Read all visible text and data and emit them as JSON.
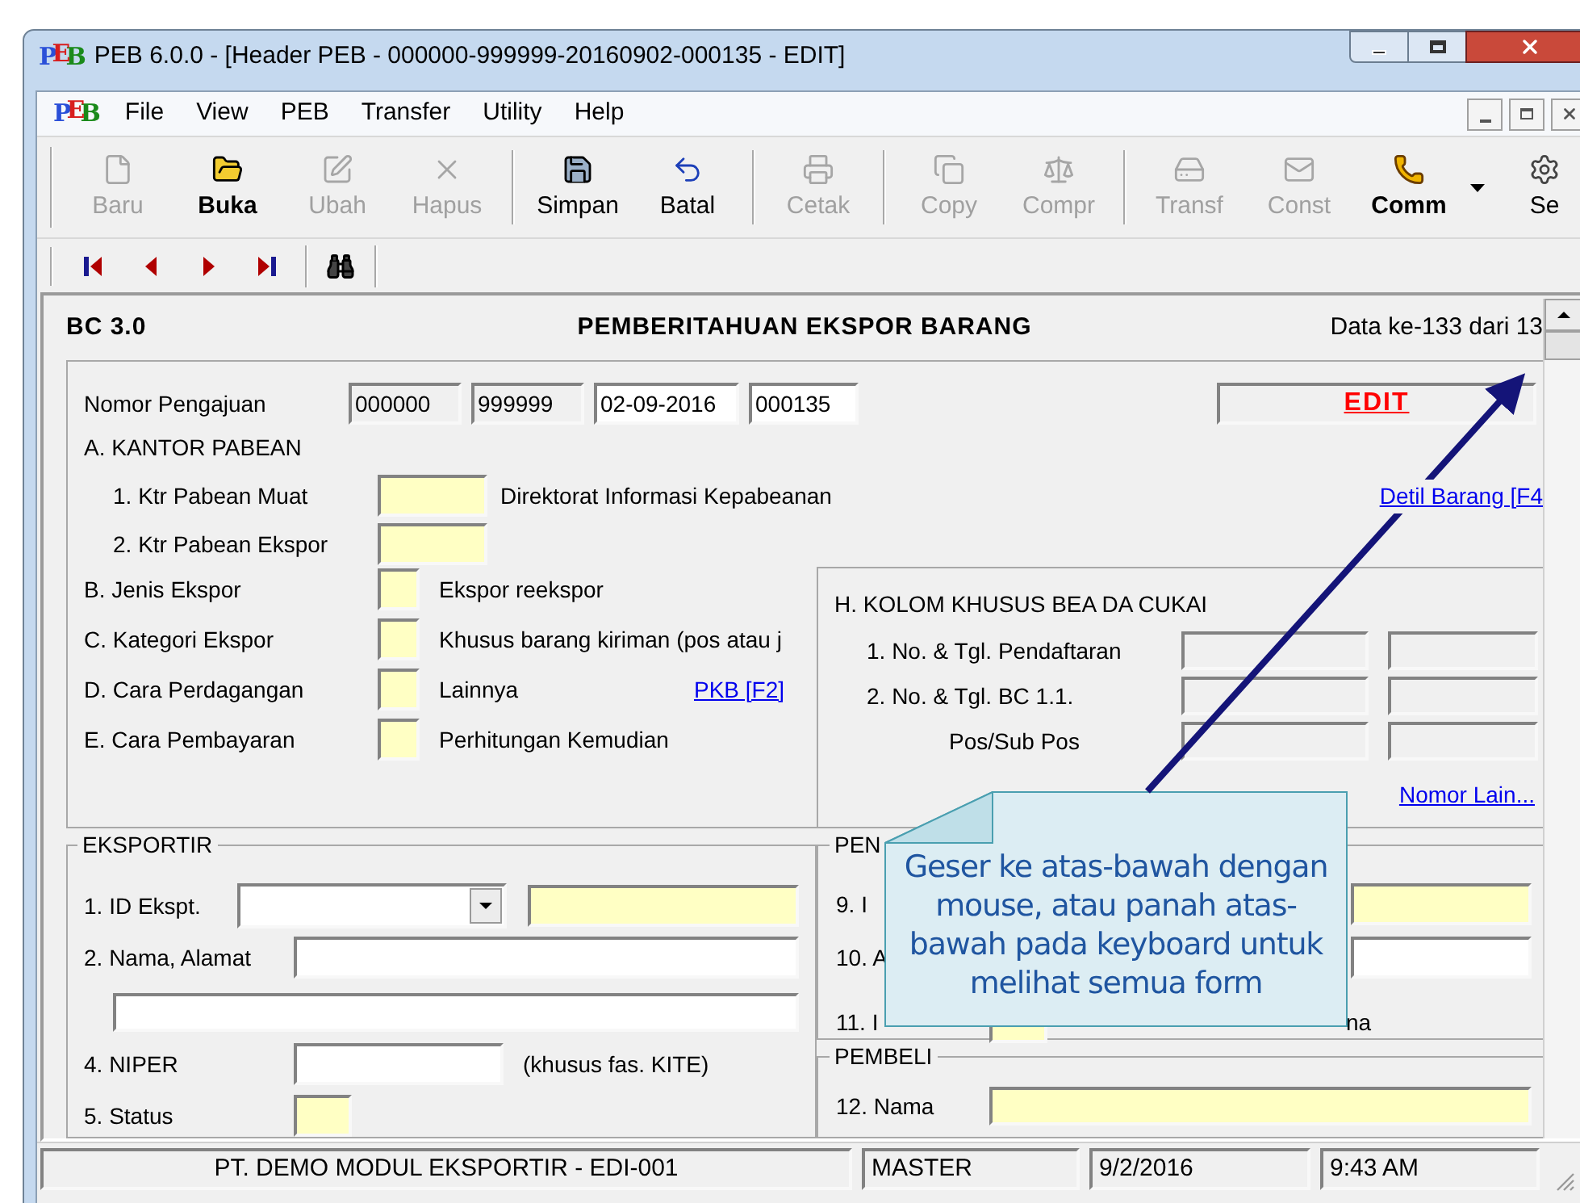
{
  "window": {
    "logo": "PEB",
    "title": "PEB 6.0.0 - [Header PEB - 000000-999999-20160902-000135 - EDIT]"
  },
  "menu_bar": {
    "logo": "PEB",
    "items": [
      "File",
      "View",
      "PEB",
      "Transfer",
      "Utility",
      "Help"
    ]
  },
  "toolbar": [
    [
      {
        "label": "Baru",
        "kind": "new",
        "disabled": true,
        "bold": false
      },
      {
        "label": "Buka",
        "kind": "open",
        "disabled": false,
        "bold": true
      },
      {
        "label": "Ubah",
        "kind": "edit",
        "disabled": true,
        "bold": false
      },
      {
        "label": "Hapus",
        "kind": "delete",
        "disabled": true,
        "bold": false
      }
    ],
    [
      {
        "label": "Simpan",
        "kind": "save",
        "disabled": false,
        "bold": false
      },
      {
        "label": "Batal",
        "kind": "undo",
        "disabled": false,
        "bold": false
      }
    ],
    [
      {
        "label": "Cetak",
        "kind": "print",
        "disabled": true,
        "bold": false
      }
    ],
    [
      {
        "label": "Copy",
        "kind": "copy",
        "disabled": true,
        "bold": false
      },
      {
        "label": "Compr",
        "kind": "compare",
        "disabled": true,
        "bold": false
      }
    ],
    [
      {
        "label": "Transf",
        "kind": "transfer",
        "disabled": true,
        "bold": false
      },
      {
        "label": "Const",
        "kind": "message",
        "disabled": true,
        "bold": false
      },
      {
        "label": "Comm",
        "kind": "phone",
        "disabled": false,
        "bold": true,
        "menu": true
      },
      {
        "label": "Se",
        "kind": "settings",
        "disabled": false,
        "bold": false
      }
    ]
  ],
  "form": {
    "code": "BC 3.0",
    "title": "PEMBERITAHUAN EKSPOR BARANG",
    "record": "Data ke-133 dari 13",
    "nomor_pengajuan": {
      "label": "Nomor Pengajuan",
      "fields": [
        {
          "value": "000000",
          "disabled": true
        },
        {
          "value": "999999",
          "disabled": true
        },
        {
          "value": "02-09-2016",
          "disabled": false
        },
        {
          "value": "000135",
          "disabled": false
        }
      ]
    },
    "mode": "EDIT",
    "kantor_pabean": {
      "heading": "A. KANTOR PABEAN",
      "rows": [
        {
          "label": "1. Ktr Pabean Muat",
          "required": true,
          "description": "Direktorat Informasi Kepabeanan",
          "link": "Detil Barang [F4"
        },
        {
          "label": "2. Ktr Pabean Ekspor",
          "required": true
        }
      ]
    },
    "code_rows": [
      {
        "label": "B. Jenis Ekspor",
        "required": true,
        "description": "Ekspor reekspor"
      },
      {
        "label": "C. Kategori Ekspor",
        "required": true,
        "description": "Khusus barang kiriman (pos atau j"
      },
      {
        "label": "D. Cara Perdagangan",
        "required": true,
        "description": "Lainnya",
        "link": "PKB [F2]"
      },
      {
        "label": "E. Cara Pembayaran",
        "required": true,
        "description": "Perhitungan Kemudian"
      }
    ],
    "bea_cukai": {
      "heading": "H. KOLOM KHUSUS BEA DA CUKAI",
      "rows": [
        {
          "label": "1. No. & Tgl. Pendaftaran"
        },
        {
          "label": "2. No. & Tgl. BC 1.1.",
          "children": [
            {
              "label": "Pos/Sub Pos"
            }
          ]
        }
      ],
      "link": "Nomor Lain..."
    },
    "eksportir": {
      "heading": "EKSPORTIR",
      "rows": [
        {
          "label": "1. ID Ekspt.",
          "fields": [
            {
              "kind": "combo",
              "required": false
            },
            {
              "kind": "text",
              "required": true
            }
          ]
        },
        {
          "label": "2. Nama, Alamat",
          "fields": [
            {
              "kind": "text",
              "required": false
            }
          ]
        },
        {
          "fields": [
            {
              "kind": "text",
              "required": false
            }
          ]
        },
        {
          "label": "4. NIPER",
          "fields": [
            {
              "kind": "text",
              "required": false
            }
          ],
          "note": "(khusus fas. KITE)"
        },
        {
          "label": "5. Status",
          "fields": [
            {
              "kind": "text",
              "required": true
            }
          ]
        }
      ]
    },
    "penerima": {
      "heading": "PEN",
      "rows": [
        {
          "label": "9. I",
          "required": true
        },
        {
          "label": "10. A",
          "required": false
        },
        {
          "label": "11. I",
          "required": true,
          "note": "na"
        }
      ]
    },
    "pembeli": {
      "heading": "PEMBELI",
      "rows": [
        {
          "label": "12. Nama",
          "required": true
        }
      ]
    }
  },
  "callout": {
    "text": "Geser ke atas-bawah dengan mouse, atau panah atas-bawah pada keyboard untuk melihat semua form"
  },
  "status_bar": [
    "PT. DEMO MODUL EKSPORTIR - EDI-001",
    "MASTER",
    "9/2/2016",
    "9:43 AM"
  ]
}
